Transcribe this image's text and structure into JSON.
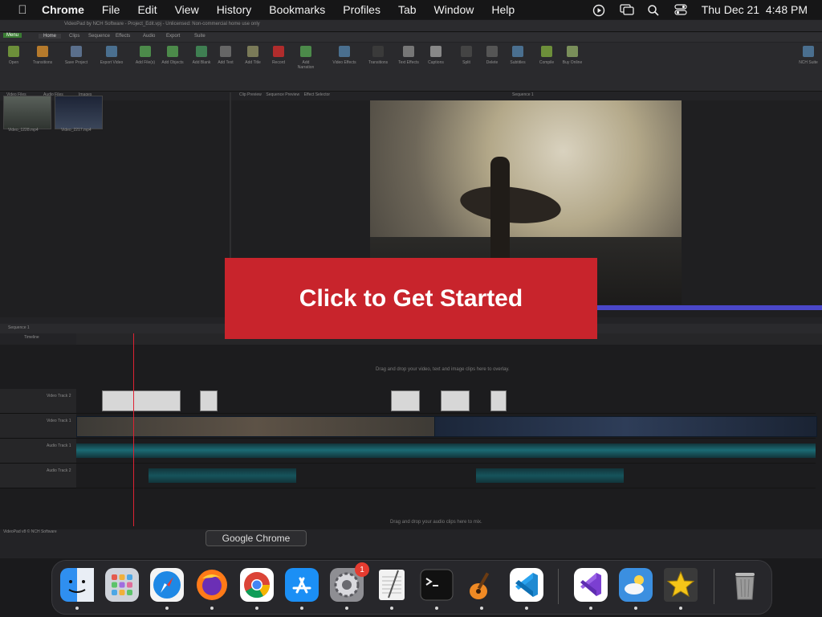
{
  "menubar": {
    "app": "Chrome",
    "items": [
      "File",
      "Edit",
      "View",
      "History",
      "Bookmarks",
      "Profiles",
      "Tab",
      "Window",
      "Help"
    ],
    "datetime": "Thu Dec 21  4:48 PM"
  },
  "editor": {
    "title": "VideoPad by NCH Software - Project_Edit.vpj - Unlicensed: Non-commercial home use only",
    "ribbon_tabs": [
      "Menu",
      "Home",
      "Clips",
      "Sequence",
      "Effects",
      "Audio",
      "Export",
      "Suite"
    ],
    "tools": [
      "Open",
      "Transitions",
      "Save Project",
      "Export Video",
      "Add File(s)",
      "Add Objects",
      "Add Blank",
      "Add Text",
      "Add Title",
      "Record",
      "Add Narration",
      "Video Effects",
      "Transitions",
      "Text Effects",
      "Captions",
      "Split",
      "Delete",
      "Subtitles",
      "Compile",
      "Buy Online",
      "NCH Suite"
    ],
    "bin_tabs": [
      "Video Files",
      "Audio Files",
      "Images"
    ],
    "bin_clips": [
      "Video_1228.mp4",
      "Video_2217.mp4"
    ],
    "preview_tabs": [
      "Clip Preview",
      "Sequence Preview",
      "Effect Selector"
    ],
    "sequence_label": "Sequence 1",
    "timeline_tab": "Sequence 1",
    "timeline_mode": "Timeline",
    "track_names": [
      "Video Track 2",
      "Video Track 1",
      "Audio Track 1",
      "Audio Track 2"
    ],
    "drop_video_hint": "Drag and drop your video, text and image clips here to overlay.",
    "drop_audio_hint": "Drag and drop your audio clips here to mix.",
    "footer": "VideoPad v8 © NCH Software"
  },
  "cta": {
    "label": "Click to Get Started"
  },
  "dock": {
    "tooltip": "Google Chrome",
    "apps": [
      {
        "name": "Finder",
        "icon": "finder-icon",
        "color": "#2f8ff0"
      },
      {
        "name": "Launchpad",
        "icon": "launchpad-icon",
        "color": "#cfd3da"
      },
      {
        "name": "Safari",
        "icon": "safari-icon",
        "color": "#1e88e5"
      },
      {
        "name": "Firefox",
        "icon": "firefox-icon",
        "color": "#ff7a18"
      },
      {
        "name": "Google Chrome",
        "icon": "chrome-icon",
        "color": "#ffffff"
      },
      {
        "name": "App Store",
        "icon": "app-store-icon",
        "color": "#1b8ff5"
      },
      {
        "name": "System Preferences",
        "icon": "settings-icon",
        "color": "#8e8e93",
        "badge": "1"
      },
      {
        "name": "TextEdit",
        "icon": "textedit-icon",
        "color": "#f2f2f2"
      },
      {
        "name": "Terminal",
        "icon": "terminal-icon",
        "color": "#111111"
      },
      {
        "name": "GarageBand",
        "icon": "garageband-icon",
        "color": "#f08a24"
      },
      {
        "name": "Visual Studio Code",
        "icon": "vscode-icon",
        "color": "#ffffff"
      },
      {
        "name": "Visual Studio",
        "icon": "visual-studio-icon",
        "color": "#ffffff"
      },
      {
        "name": "Weather",
        "icon": "weather-icon",
        "color": "#3b8fe0"
      },
      {
        "name": "Reeder",
        "icon": "star-icon",
        "color": "#3a3a3a"
      },
      {
        "name": "Trash",
        "icon": "trash-icon",
        "color": "#9a9a9a"
      }
    ]
  }
}
